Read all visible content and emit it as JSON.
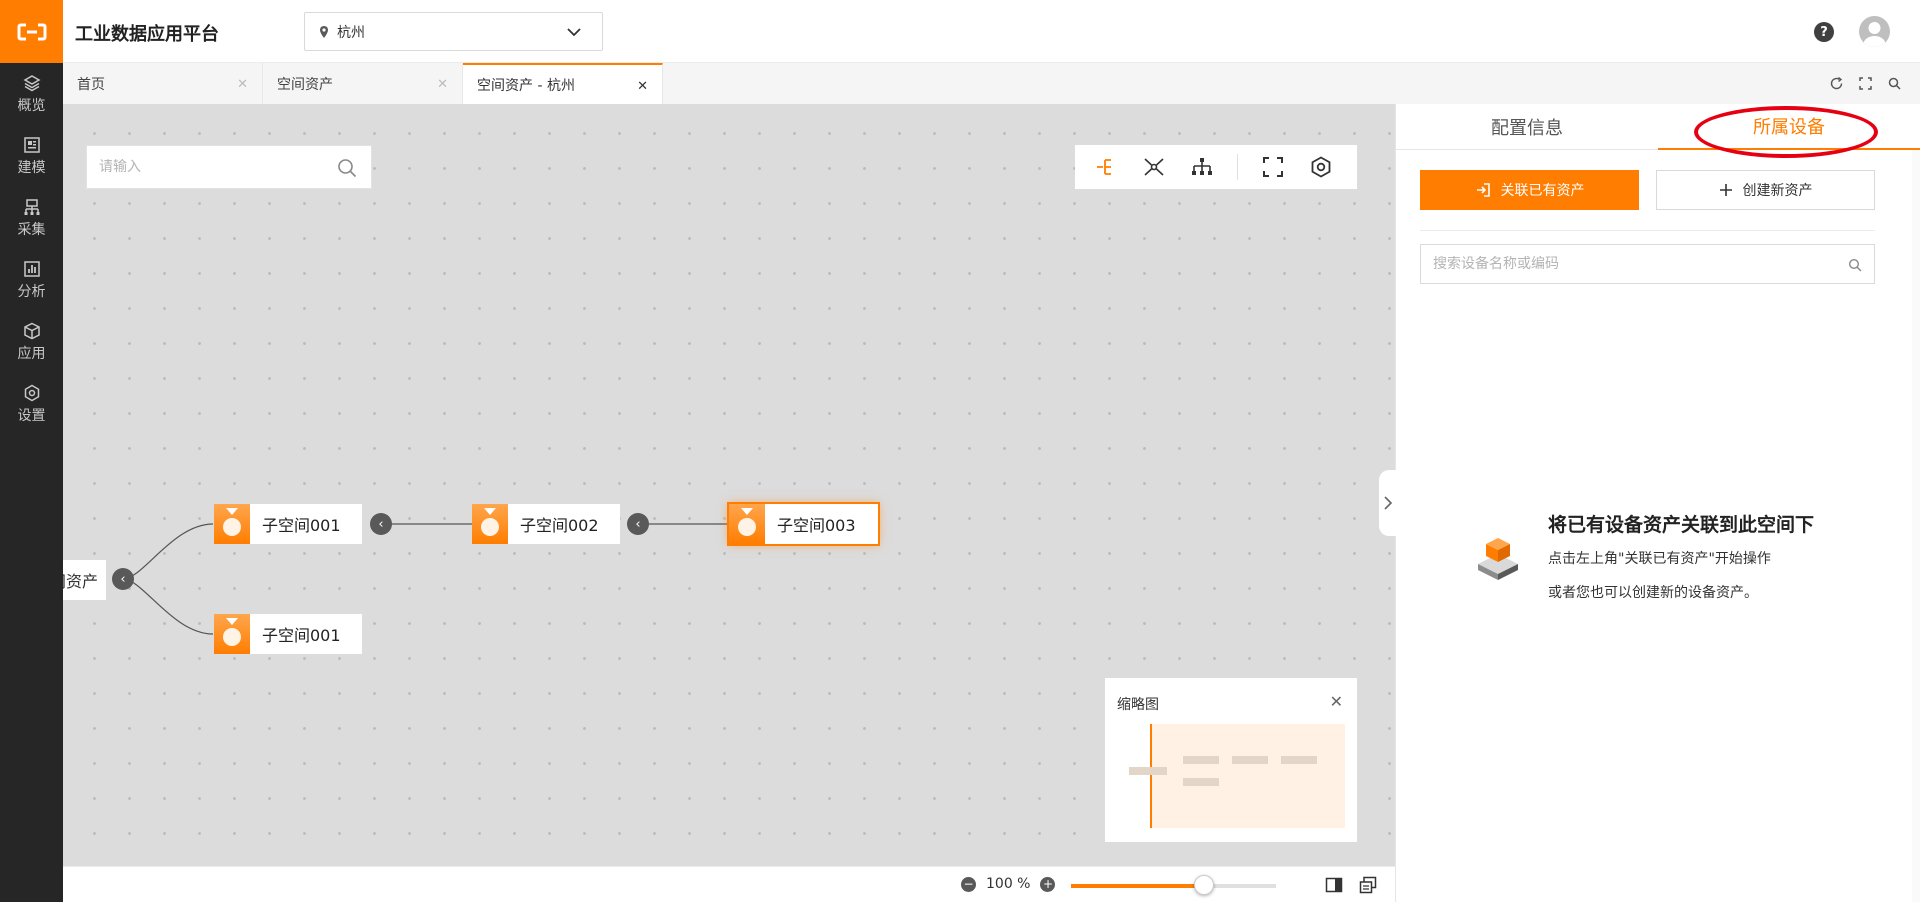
{
  "nav": {
    "items": [
      {
        "label": "概览",
        "icon": "layers-icon"
      },
      {
        "label": "建模",
        "icon": "model-icon"
      },
      {
        "label": "采集",
        "icon": "collect-icon"
      },
      {
        "label": "分析",
        "icon": "chart-icon"
      },
      {
        "label": "应用",
        "icon": "cube-icon"
      },
      {
        "label": "设置",
        "icon": "gear-icon"
      }
    ]
  },
  "header": {
    "title": "工业数据应用平台",
    "city": "杭州",
    "help": "?"
  },
  "tabs": [
    {
      "label": "首页"
    },
    {
      "label": "空间资产"
    },
    {
      "label": "空间资产 - 杭州",
      "active": true
    }
  ],
  "canvas": {
    "search_placeholder": "请输入",
    "root_label": "空间资产",
    "nodes": [
      {
        "label": "子空间001"
      },
      {
        "label": "子空间002"
      },
      {
        "label": "子空间003",
        "selected": true
      },
      {
        "label": "子空间001"
      }
    ],
    "minimap_title": "缩略图"
  },
  "bottom": {
    "zoom": "100 %",
    "zoom_fraction": 0.65
  },
  "panel": {
    "tabs": [
      {
        "label": "配置信息"
      },
      {
        "label": "所属设备",
        "active": true
      }
    ],
    "link_button": "关联已有资产",
    "create_button": "创建新资产",
    "search_placeholder": "搜索设备名称或编码",
    "empty_title": "将已有设备资产关联到此空间下",
    "empty_line1": "点击左上角\"关联已有资产\"开始操作",
    "empty_line2": "或者您也可以创建新的设备资产。"
  },
  "colors": {
    "accent": "#ff7d00",
    "nav_bg": "#262626",
    "highlight": "#e60012"
  }
}
